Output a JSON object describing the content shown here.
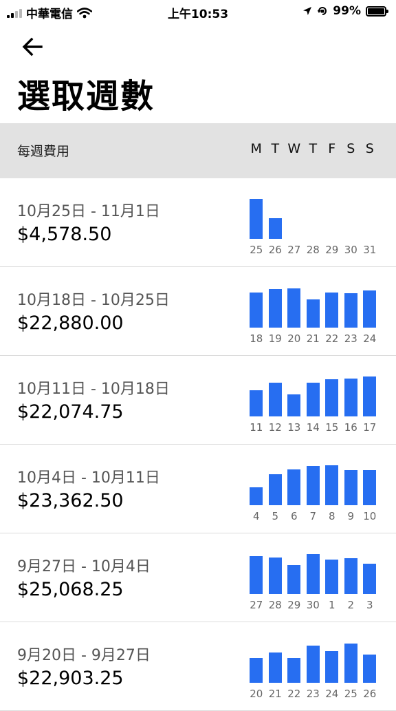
{
  "status_bar": {
    "carrier": "中華電信",
    "time": "上午10:53",
    "battery": "99%",
    "icons": [
      "signal-icon",
      "wifi-icon",
      "location-arrow-icon",
      "orientation-lock-icon",
      "battery-icon"
    ]
  },
  "page": {
    "title": "選取週數"
  },
  "header": {
    "label": "每週費用",
    "days": [
      "M",
      "T",
      "W",
      "T",
      "F",
      "S",
      "S"
    ]
  },
  "colors": {
    "bar": "#276ef1",
    "header_bg": "#e2e2e2"
  },
  "weeks": [
    {
      "range": "10月25日 - 11月1日",
      "amount": "$4,578.50",
      "dates": [
        "25",
        "26",
        "27",
        "28",
        "29",
        "30",
        "31"
      ],
      "daily_values": [
        1.0,
        0.52,
        0,
        0,
        0,
        0,
        0
      ]
    },
    {
      "range": "10月18日 - 10月25日",
      "amount": "$22,880.00",
      "dates": [
        "18",
        "19",
        "20",
        "21",
        "22",
        "23",
        "24"
      ],
      "daily_values": [
        0.88,
        0.96,
        0.98,
        0.71,
        0.88,
        0.86,
        0.93
      ]
    },
    {
      "range": "10月11日 - 10月18日",
      "amount": "$22,074.75",
      "dates": [
        "11",
        "12",
        "13",
        "14",
        "15",
        "16",
        "17"
      ],
      "daily_values": [
        0.66,
        0.84,
        0.55,
        0.84,
        0.93,
        0.95,
        1.0
      ]
    },
    {
      "range": "10月4日 - 10月11日",
      "amount": "$23,362.50",
      "dates": [
        "4",
        "5",
        "6",
        "7",
        "8",
        "9",
        "10"
      ],
      "daily_values": [
        0.45,
        0.77,
        0.89,
        0.98,
        1.0,
        0.88,
        0.88
      ]
    },
    {
      "range": "9月27日 - 10月4日",
      "amount": "$25,068.25",
      "dates": [
        "27",
        "28",
        "29",
        "30",
        "1",
        "2",
        "3"
      ],
      "daily_values": [
        0.95,
        0.91,
        0.73,
        1.0,
        0.86,
        0.89,
        0.75
      ]
    },
    {
      "range": "9月20日 - 9月27日",
      "amount": "$22,903.25",
      "dates": [
        "20",
        "21",
        "22",
        "23",
        "24",
        "25",
        "26"
      ],
      "daily_values": [
        0.62,
        0.75,
        0.62,
        0.93,
        0.8,
        0.98,
        0.71
      ]
    }
  ]
}
